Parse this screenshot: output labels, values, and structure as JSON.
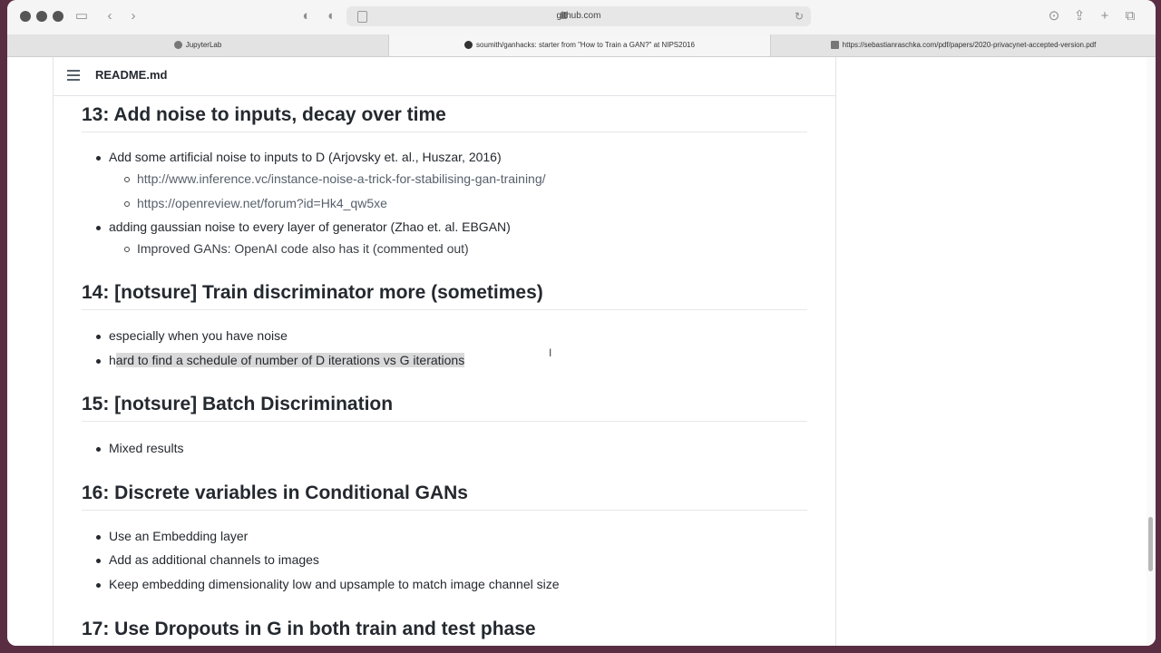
{
  "browser": {
    "url": "github.com",
    "tabs": [
      {
        "label": "JupyterLab"
      },
      {
        "label": "soumith/ganhacks: starter from \"How to Train a GAN?\" at NIPS2016"
      },
      {
        "label": "https://sebastianraschka.com/pdf/papers/2020-privacynet-accepted-version.pdf"
      }
    ]
  },
  "readme": {
    "title": "README.md",
    "sections": [
      {
        "heading": "13: Add noise to inputs, decay over time",
        "items": [
          "Add some artificial noise to inputs to D (Arjovsky et. al., Huszar, 2016)",
          "http://www.inference.vc/instance-noise-a-trick-for-stabilising-gan-training/",
          "https://openreview.net/forum?id=Hk4_qw5xe",
          "adding gaussian noise to every layer of generator (Zhao et. al. EBGAN)",
          "Improved GANs: OpenAI code also has it (commented out)"
        ]
      },
      {
        "heading": "14: [notsure] Train discriminator more (sometimes)",
        "items": [
          "especially when you have noise",
          "h",
          "ard to find a schedule of number of D iterations vs G iterations"
        ]
      },
      {
        "heading": "15: [notsure] Batch Discrimination",
        "items": [
          "Mixed results"
        ]
      },
      {
        "heading": "16: Discrete variables in Conditional GANs",
        "items": [
          "Use an Embedding layer",
          "Add as additional channels to images",
          "Keep embedding dimensionality low and upsample to match image channel size"
        ]
      },
      {
        "heading": "17: Use Dropouts in G in both train and test phase",
        "items": []
      }
    ]
  },
  "colors": {
    "desktop": "#5a2e42",
    "text": "#24292f",
    "selection": "#d9d9d9"
  }
}
